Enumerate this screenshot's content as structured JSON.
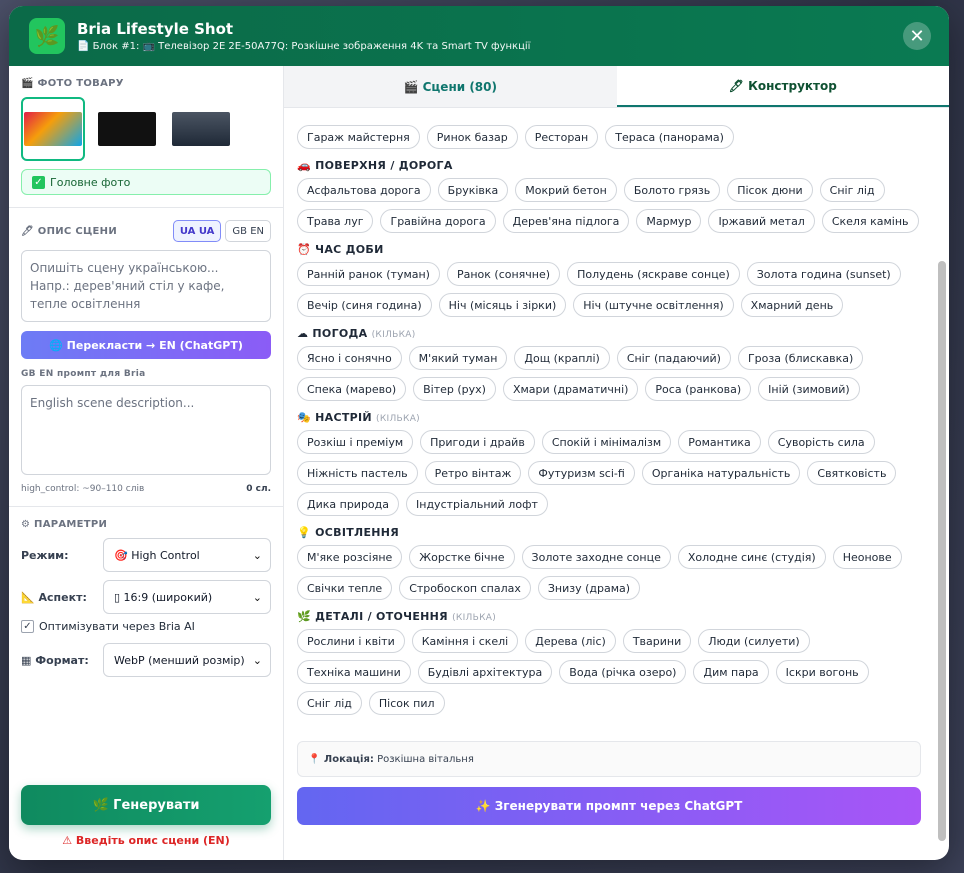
{
  "header": {
    "title": "Bria Lifestyle Shot",
    "subtitle": "📄 Блок #1: 📺 Телевізор 2E 2E-50A77Q: Розкішне зображення 4K та Smart TV функції",
    "close": "✕"
  },
  "left": {
    "photo_label": "🎬 ФОТО ТОВАРУ",
    "main_photo": "Головне фото",
    "scene_label": "🖊 ОПИС СЦЕНИ",
    "lang_ua": "UA UA",
    "lang_en": "GB EN",
    "scene_placeholder": "Опишіть сцену українською...\nНапр.: дерев'яний стіл у кафе, тепле освітлення",
    "translate_button": "🌐 Перекласти → EN (ChatGPT)",
    "en_prompt_label": "GB EN промпт для Bria",
    "en_placeholder": "English scene description...",
    "hint": "high_control: ~90–110 слів",
    "word_count": "0 сл.",
    "params_label": "⚙ ПАРАМЕТРИ",
    "mode_label": "Режим:",
    "mode_value": "🎯 High Control",
    "aspect_label": "📐 Аспект:",
    "aspect_value": "▯ 16:9 (широкий)",
    "optimize_label": "Оптимізувати через Bria AI",
    "format_label": "▦ Формат:",
    "format_value": "WebP (менший розмір)",
    "generate_button": "🌿 Генерувати",
    "warning": "⚠ Введіть опис сцени (EN)"
  },
  "tabs": {
    "scenes": "🎬 Сцени (80)",
    "constructor": "🖊 Конструктор"
  },
  "groups": [
    {
      "title": "",
      "hint": "",
      "chips": [
        "Гараж майстерня",
        "Ринок базар",
        "Ресторан",
        "Тераса (панорама)"
      ]
    },
    {
      "title": "🚗 ПОВЕРХНЯ / ДОРОГА",
      "hint": "",
      "chips": [
        "Асфальтова дорога",
        "Бруківка",
        "Мокрий бетон",
        "Болото грязь",
        "Пісок дюни",
        "Сніг лід",
        "Трава луг",
        "Гравійна дорога",
        "Дерев'яна підлога",
        "Мармур",
        "Іржавий метал",
        "Скеля камінь"
      ]
    },
    {
      "title": "⏰ ЧАС ДОБИ",
      "hint": "",
      "chips": [
        "Ранній ранок (туман)",
        "Ранок (сонячне)",
        "Полудень (яскраве сонце)",
        "Золота година (sunset)",
        "Вечір (синя година)",
        "Ніч (місяць і зірки)",
        "Ніч (штучне освітлення)",
        "Хмарний день"
      ]
    },
    {
      "title": "☁ ПОГОДА",
      "hint": "(КІЛЬКА)",
      "chips": [
        "Ясно і сонячно",
        "М'який туман",
        "Дощ (краплі)",
        "Сніг (падаючий)",
        "Гроза (блискавка)",
        "Спека (марево)",
        "Вітер (рух)",
        "Хмари (драматичні)",
        "Роса (ранкова)",
        "Іній (зимовий)"
      ]
    },
    {
      "title": "🎭 НАСТРІЙ",
      "hint": "(КІЛЬКА)",
      "chips": [
        "Розкіш і преміум",
        "Пригоди і драйв",
        "Спокій і мінімалізм",
        "Романтика",
        "Суворість сила",
        "Ніжність пастель",
        "Ретро вінтаж",
        "Футуризм sci-fi",
        "Органіка натуральність",
        "Святковість",
        "Дика природа",
        "Індустріальний лофт"
      ]
    },
    {
      "title": "💡 ОСВІТЛЕННЯ",
      "hint": "",
      "chips": [
        "М'яке розсіяне",
        "Жорстке бічне",
        "Золоте заходне сонце",
        "Холодне синє (студія)",
        "Неонове",
        "Свічки тепле",
        "Стробоскоп спалах",
        "Знизу (драма)"
      ]
    },
    {
      "title": "🌿 ДЕТАЛІ / ОТОЧЕННЯ",
      "hint": "(КІЛЬКА)",
      "chips": [
        "Рослини і квіти",
        "Каміння і скелі",
        "Дерева (ліс)",
        "Тварини",
        "Люди (силуети)",
        "Техніка машини",
        "Будівлі архітектура",
        "Вода (річка озеро)",
        "Дим пара",
        "Іскри вогонь",
        "Сніг лід",
        "Пісок пил"
      ]
    }
  ],
  "location_label": "📍 Локація:",
  "location_value": "Розкішна вітальня",
  "chatgpt_button": "✨ Згенерувати промпт через ChatGPT"
}
